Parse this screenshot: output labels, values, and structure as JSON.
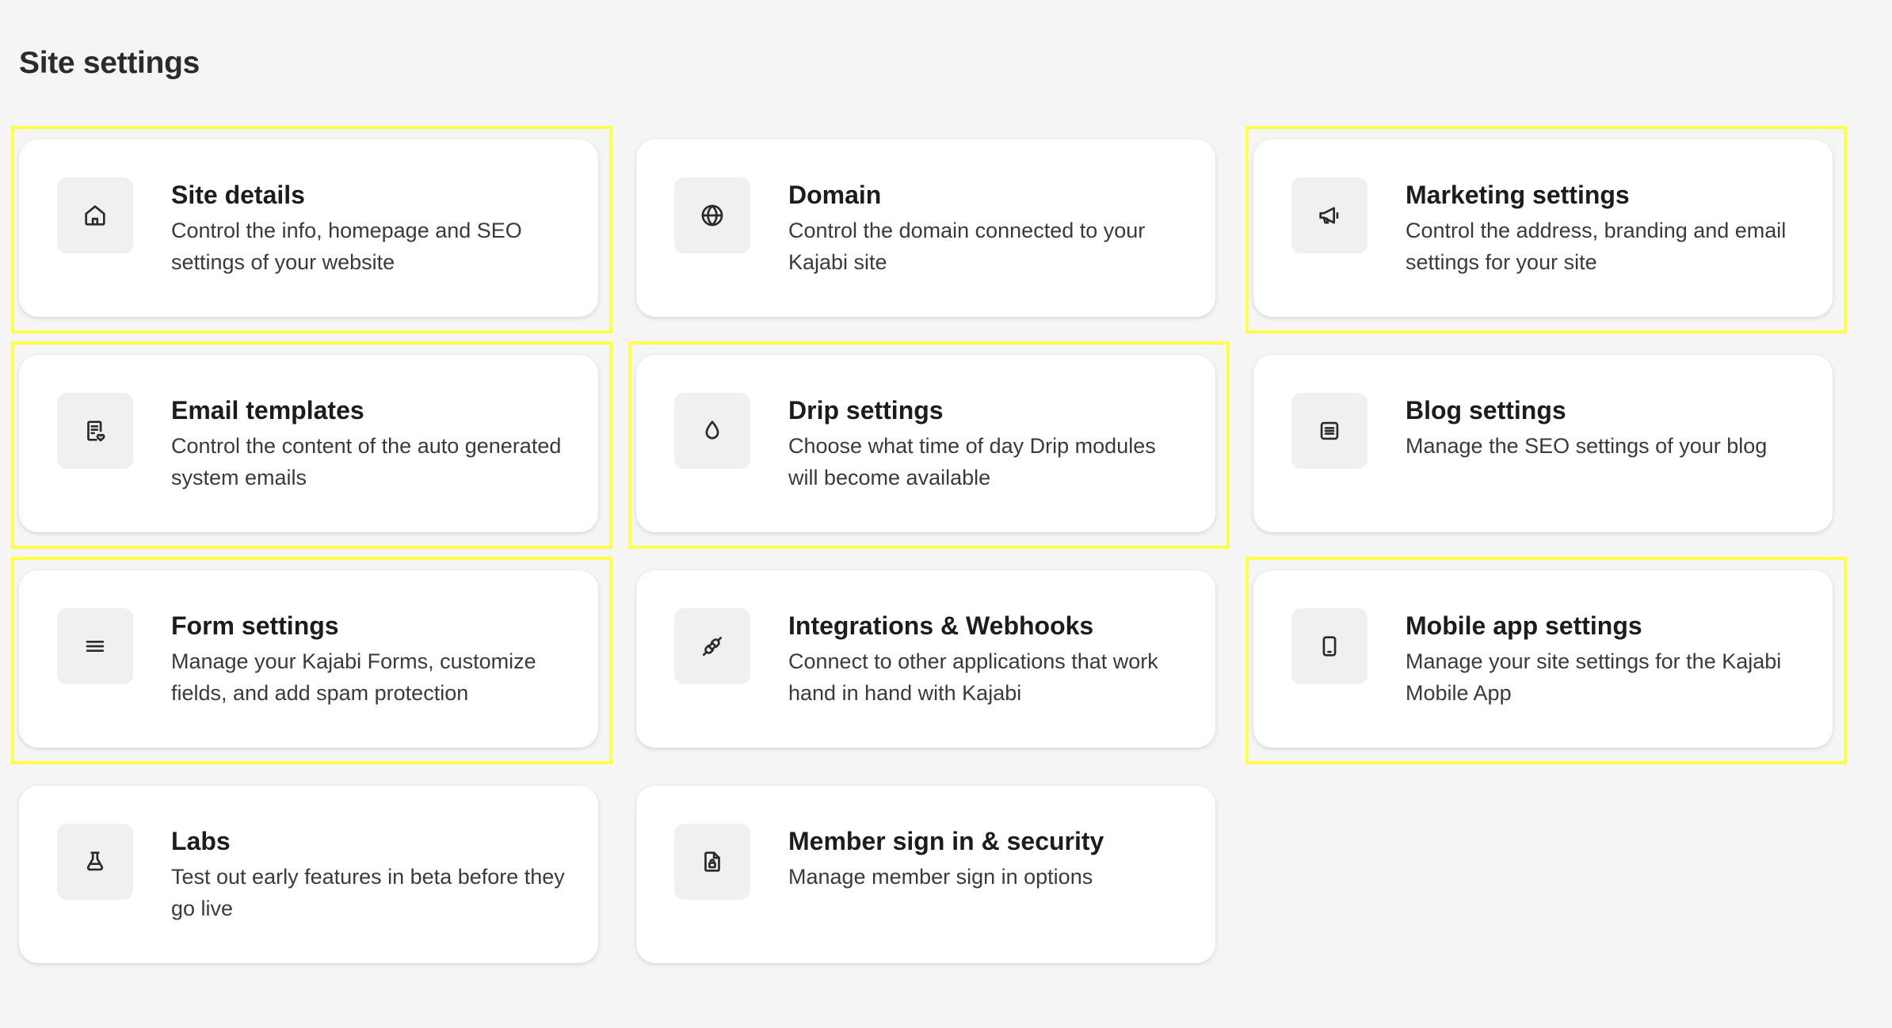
{
  "page": {
    "title": "Site settings"
  },
  "colors": {
    "background": "#f5f5f5",
    "card": "#ffffff",
    "icon_box": "#f0f0f0",
    "highlight": "#ffff4a"
  },
  "cards": [
    {
      "title": "Site details",
      "description": "Control the info, homepage and SEO settings of your website",
      "icon": "home-icon",
      "highlighted": true
    },
    {
      "title": "Domain",
      "description": "Control the domain connected to your Kajabi site",
      "icon": "globe-icon",
      "highlighted": false
    },
    {
      "title": "Marketing settings",
      "description": "Control the address, branding and email settings for your site",
      "icon": "megaphone-icon",
      "highlighted": true
    },
    {
      "title": "Email templates",
      "description": "Control the content of the auto generated system emails",
      "icon": "email-template-icon",
      "highlighted": true
    },
    {
      "title": "Drip settings",
      "description": "Choose what time of day Drip modules will become available",
      "icon": "droplet-icon",
      "highlighted": true
    },
    {
      "title": "Blog settings",
      "description": "Manage the SEO settings of your blog",
      "icon": "blog-icon",
      "highlighted": false
    },
    {
      "title": "Form settings",
      "description": "Manage your Kajabi Forms, customize fields, and add spam protection",
      "icon": "menu-lines-icon",
      "highlighted": true
    },
    {
      "title": "Integrations & Webhooks",
      "description": "Connect to other applications that work hand in hand with Kajabi",
      "icon": "plug-icon",
      "highlighted": false
    },
    {
      "title": "Mobile app settings",
      "description": "Manage your site settings for the Kajabi Mobile App",
      "icon": "mobile-icon",
      "highlighted": true
    },
    {
      "title": "Labs",
      "description": "Test out early features in beta before they go live",
      "icon": "flask-icon",
      "highlighted": false
    },
    {
      "title": "Member sign in & security",
      "description": "Manage member sign in options",
      "icon": "lock-document-icon",
      "highlighted": false
    }
  ]
}
